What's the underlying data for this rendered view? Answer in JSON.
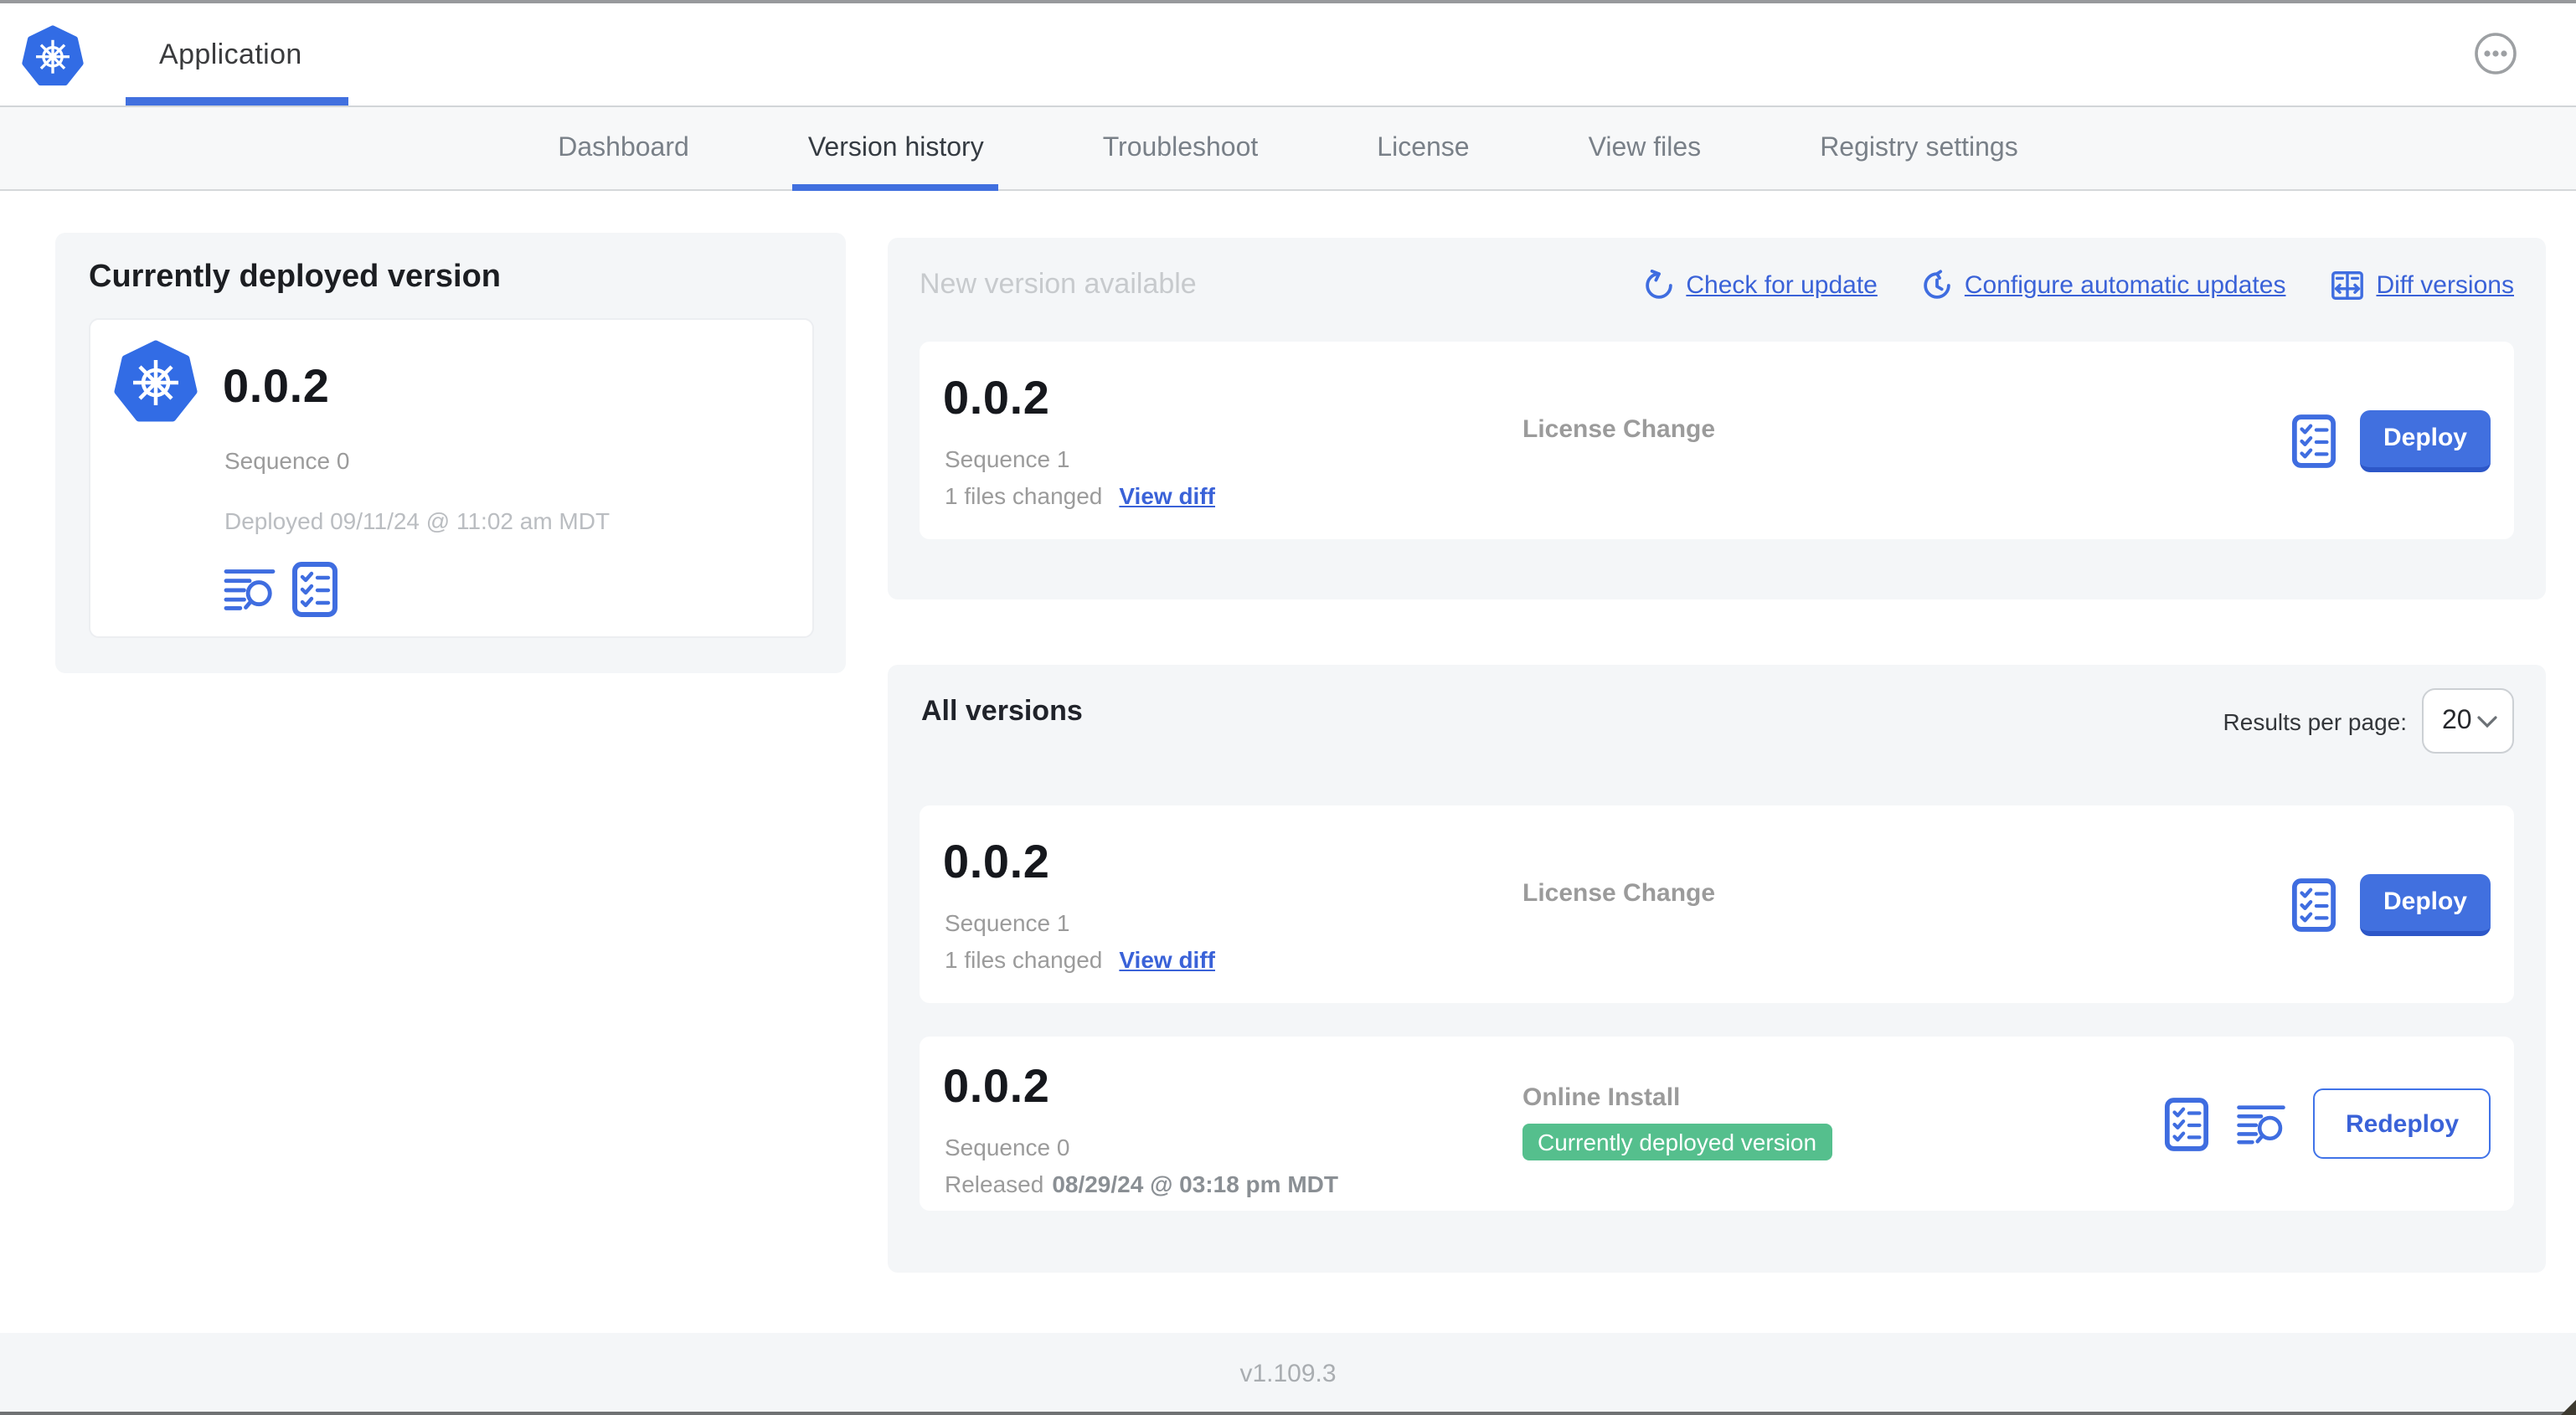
{
  "topbar": {
    "app_title": "Application"
  },
  "subnav": {
    "tabs": [
      {
        "label": "Dashboard"
      },
      {
        "label": "Version history"
      },
      {
        "label": "Troubleshoot"
      },
      {
        "label": "License"
      },
      {
        "label": "View files"
      },
      {
        "label": "Registry settings"
      }
    ]
  },
  "current_version_panel": {
    "title": "Currently deployed version",
    "version": "0.0.2",
    "sequence": "Sequence 0",
    "deployed": "Deployed 09/11/24 @ 11:02 am MDT"
  },
  "new_version_panel": {
    "title": "New version available",
    "check_for_update": "Check for update",
    "configure_automatic_updates": "Configure automatic updates",
    "diff_versions": "Diff versions",
    "row": {
      "version": "0.0.2",
      "sequence": "Sequence 1",
      "files_changed": "1 files changed",
      "view_diff": "View diff",
      "source": "License Change",
      "action": "Deploy"
    }
  },
  "all_versions_panel": {
    "title": "All versions",
    "results_per_page_label": "Results per page:",
    "results_per_page_value": "20",
    "rows": [
      {
        "version": "0.0.2",
        "sequence": "Sequence 1",
        "files_changed": "1 files changed",
        "view_diff": "View diff",
        "source": "License Change",
        "action": "Deploy"
      },
      {
        "version": "0.0.2",
        "sequence": "Sequence 0",
        "released_prefix": "Released",
        "released_date": "08/29/24 @ 03:18 pm MDT",
        "source": "Online Install",
        "badge": "Currently deployed version",
        "action": "Redeploy"
      }
    ]
  },
  "footer": {
    "app_version": "v1.109.3"
  },
  "colors": {
    "primary_blue": "#3a62d8",
    "button_blue": "#4170df",
    "badge_green": "#55bf8d",
    "kubernetes_blue": "#326ce5",
    "panel_gray": "#f4f6f8"
  },
  "icons": {
    "kubernetes-logo-icon": "blue heptagon with white helm wheel",
    "ellipsis-icon": "circled three dots",
    "refresh-icon": "circular arrow",
    "schedule-update-icon": "clock with circular arrow",
    "diff-icon": "split document with left-right arrow",
    "logs-icon": "text lines with magnifier",
    "preflight-checklist-icon": "bordered checklist",
    "chevron-down-icon": "down chevron"
  }
}
